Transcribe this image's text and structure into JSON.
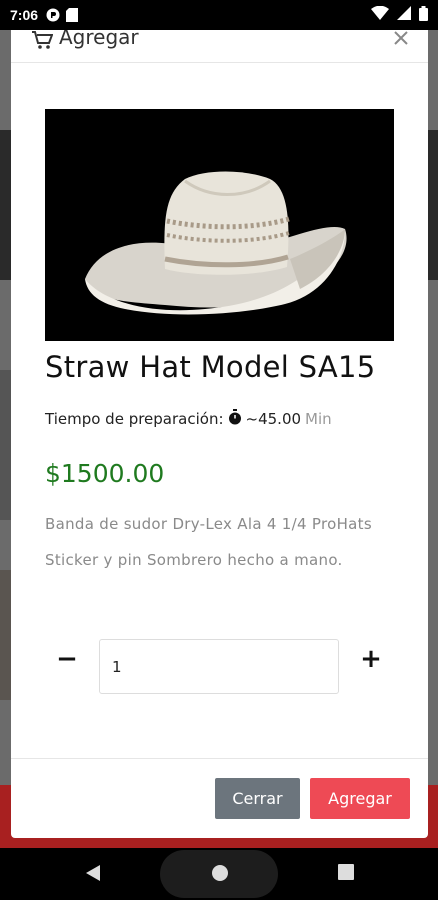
{
  "status_bar": {
    "time": "7:06"
  },
  "modal": {
    "header_title": "Agregar",
    "product": {
      "name": "Straw Hat Model SA15",
      "prep_label": "Tiempo de preparación:",
      "prep_value": "~45.00",
      "prep_unit": "Min",
      "price": "$1500.00",
      "description": "Banda de sudor Dry-Lex Ala 4 1/4 ProHats Sticker y pin Sombrero hecho a mano."
    },
    "quantity": {
      "minus_label": "−",
      "plus_label": "+",
      "value": "1"
    },
    "buttons": {
      "close_label": "Cerrar",
      "add_label": "Agregar"
    }
  },
  "colors": {
    "price": "#1f7a1f",
    "close_button": "#6c757d",
    "add_button": "#ee4a55"
  }
}
